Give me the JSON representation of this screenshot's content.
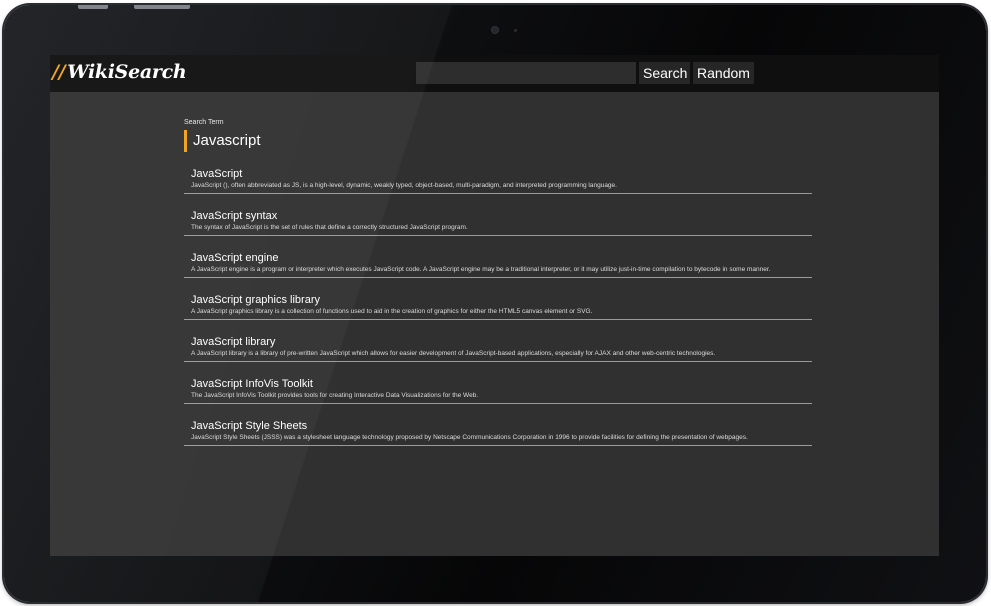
{
  "app": {
    "logo_slashes": "//",
    "logo_text": "WikiSearch"
  },
  "navbar": {
    "search_value": "",
    "search_label": "Search",
    "random_label": "Random"
  },
  "search": {
    "term_label": "Search Term",
    "term": "Javascript"
  },
  "results": [
    {
      "title": "JavaScript",
      "description": "JavaScript (), often abbreviated as JS, is a high-level, dynamic, weakly typed, object-based, multi-paradigm, and interpreted programming language."
    },
    {
      "title": "JavaScript syntax",
      "description": "The syntax of JavaScript is the set of rules that define a correctly structured JavaScript program."
    },
    {
      "title": "JavaScript engine",
      "description": "A JavaScript engine is a program or interpreter which executes JavaScript code. A JavaScript engine may be a traditional interpreter, or it may utilize just-in-time compilation to bytecode in some manner."
    },
    {
      "title": "JavaScript graphics library",
      "description": "A JavaScript graphics library is a collection of functions used to aid in the creation of graphics for either the HTML5 canvas element or SVG."
    },
    {
      "title": "JavaScript library",
      "description": "A JavaScript library is a library of pre-written JavaScript which allows for easier development of JavaScript-based applications, especially for AJAX and other web-centric technologies."
    },
    {
      "title": "JavaScript InfoVis Toolkit",
      "description": "The JavaScript InfoVis Toolkit provides tools for creating Interactive Data Visualizations for the Web."
    },
    {
      "title": "JavaScript Style Sheets",
      "description": "JavaScript Style Sheets (JSSS) was a stylesheet language technology proposed by Netscape Communications Corporation in 1996 to provide facilities for defining the presentation of webpages."
    }
  ],
  "colors": {
    "accent": "#f2a21a",
    "navbar_bg": "#0f0f0f",
    "page_bg": "#303030",
    "divider": "#9a9a9a"
  }
}
